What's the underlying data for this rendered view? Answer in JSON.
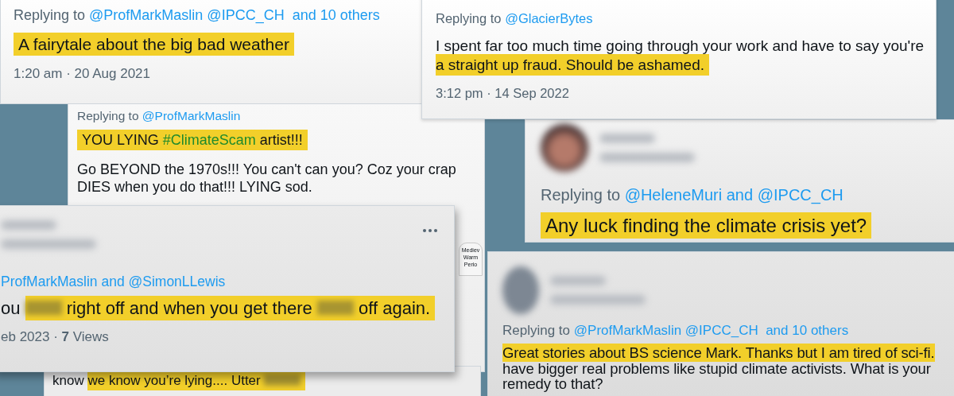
{
  "cards": [
    {
      "reply_prefix": "Replying to",
      "reply_to": "@ProfMarkMaslin @IPCC_CH  and 10 others",
      "paragraphs": [
        [
          {
            "text": "A fairytale about the big bad weather",
            "highlight": true
          }
        ]
      ],
      "time": "1:20 am · 20 Aug 2021"
    },
    {
      "reply_prefix": "Replying to",
      "reply_to": "@GlacierBytes",
      "paragraphs": [
        [
          {
            "text": "I spent far too much time going through your work and have to say you're",
            "highlight": false,
            "line_break": true
          },
          {
            "text": "a straight up fraud. Should be ashamed.",
            "highlight": true
          }
        ]
      ],
      "time": "3:12 pm · 14 Sep 2022"
    },
    {
      "reply_prefix": "Replying to",
      "reply_to": "@ProfMarkMaslin",
      "paragraphs": [
        [
          {
            "text": "YOU LYING",
            "highlight": true
          },
          {
            "text": "#ClimateScam",
            "highlight": true,
            "kind": "hashtag"
          },
          {
            "text": "artist!!!",
            "highlight": true
          }
        ],
        [
          {
            "text": "Go BEYOND the 1970s!!! You can't can you? Coz your crap DIES when you do that!!! LYING sod.",
            "highlight": false
          }
        ]
      ]
    },
    {
      "avatar": true,
      "author_blurred": true,
      "reply_prefix": "Replying to",
      "reply_to": "@HeleneMuri and @IPCC_CH",
      "paragraphs": [
        [
          {
            "text": "Any luck finding the climate crisis yet?",
            "highlight": true
          }
        ]
      ]
    },
    {
      "author_blurred": true,
      "menu": true,
      "reply_to": "ProfMarkMaslin and @SimonLLewis",
      "paragraphs": [
        [
          {
            "text": "ou",
            "highlight": false
          },
          {
            "kind": "redacted",
            "highlight": true
          },
          {
            "text": "right off and when you get there",
            "highlight": true
          },
          {
            "kind": "redacted",
            "highlight": true
          },
          {
            "text": "off again.",
            "highlight": true
          }
        ]
      ],
      "time": "eb 2023 · **7** Views"
    },
    {
      "paragraphs": [
        [
          {
            "text": "know",
            "highlight": false
          },
          {
            "text": "we know you’re lying.... Utter",
            "highlight": true
          },
          {
            "kind": "redacted",
            "highlight": true
          }
        ]
      ]
    },
    {
      "avatar": true,
      "author_blurred": true,
      "reply_prefix": "Replying to",
      "reply_to": "@ProfMarkMaslin @IPCC_CH  and 10 others",
      "paragraphs": [
        [
          {
            "text": "Great stories about BS science Mark. Thanks but I am tired of sci-fi.",
            "highlight": true,
            "line_break": true
          },
          {
            "text": "have bigger real problems like stupid climate activists. What is your remedy to that?",
            "highlight": false
          }
        ]
      ]
    }
  ],
  "chart_label": {
    "lines": [
      "Mediev",
      "Warm",
      "Perio"
    ]
  }
}
